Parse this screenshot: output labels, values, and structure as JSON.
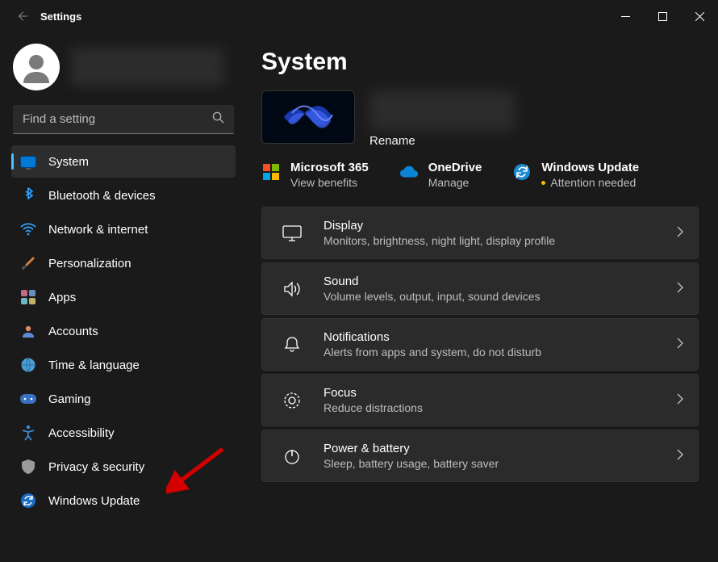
{
  "window": {
    "title": "Settings"
  },
  "search": {
    "placeholder": "Find a setting"
  },
  "sidebar": {
    "items": [
      {
        "label": "System"
      },
      {
        "label": "Bluetooth & devices"
      },
      {
        "label": "Network & internet"
      },
      {
        "label": "Personalization"
      },
      {
        "label": "Apps"
      },
      {
        "label": "Accounts"
      },
      {
        "label": "Time & language"
      },
      {
        "label": "Gaming"
      },
      {
        "label": "Accessibility"
      },
      {
        "label": "Privacy & security"
      },
      {
        "label": "Windows Update"
      }
    ]
  },
  "page": {
    "title": "System",
    "rename": "Rename"
  },
  "services": {
    "m365": {
      "title": "Microsoft 365",
      "subtitle": "View benefits"
    },
    "onedrive": {
      "title": "OneDrive",
      "subtitle": "Manage"
    },
    "update": {
      "title": "Windows Update",
      "subtitle": "Attention needed"
    }
  },
  "cards": [
    {
      "title": "Display",
      "subtitle": "Monitors, brightness, night light, display profile"
    },
    {
      "title": "Sound",
      "subtitle": "Volume levels, output, input, sound devices"
    },
    {
      "title": "Notifications",
      "subtitle": "Alerts from apps and system, do not disturb"
    },
    {
      "title": "Focus",
      "subtitle": "Reduce distractions"
    },
    {
      "title": "Power & battery",
      "subtitle": "Sleep, battery usage, battery saver"
    }
  ]
}
